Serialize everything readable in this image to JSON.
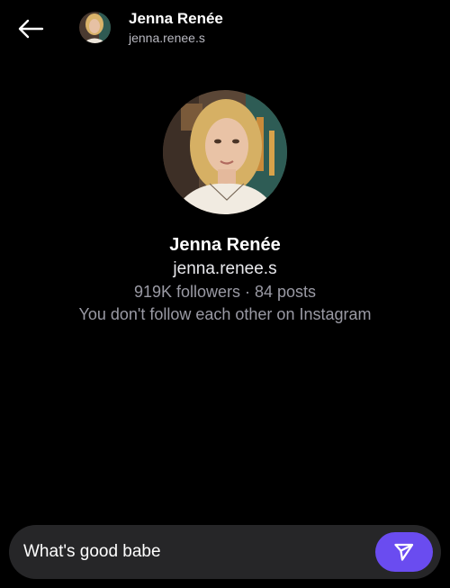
{
  "header": {
    "name": "Jenna Renée",
    "username": "jenna.renee.s",
    "back_icon": "arrow-left-icon"
  },
  "profile": {
    "name": "Jenna Renée",
    "username": "jenna.renee.s",
    "stats": "919K followers · 84 posts",
    "note": "You don't follow each other on Instagram"
  },
  "composer": {
    "message_value": "What's good babe",
    "send_icon": "send-icon"
  },
  "colors": {
    "background": "#000000",
    "composer_bg": "#262628",
    "accent": "#6a4cf0",
    "secondary_text": "#9a9aa4"
  }
}
